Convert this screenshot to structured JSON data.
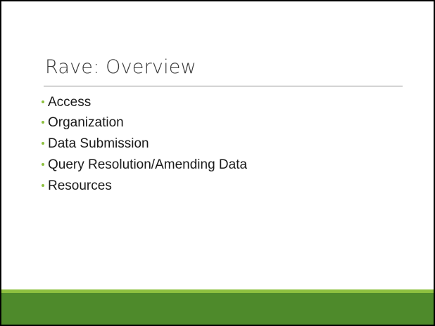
{
  "slide": {
    "title": "Rave: Overview",
    "bullets": [
      "Access",
      "Organization",
      "Data Submission",
      "Query Resolution/Amending Data",
      "Resources"
    ]
  },
  "colors": {
    "bullet_accent": "#8dc03f",
    "footer_band_light": "#8dc03f",
    "footer_band_dark": "#4e8a2b",
    "title_text": "#3a3a3a",
    "frame_border": "#000000"
  }
}
